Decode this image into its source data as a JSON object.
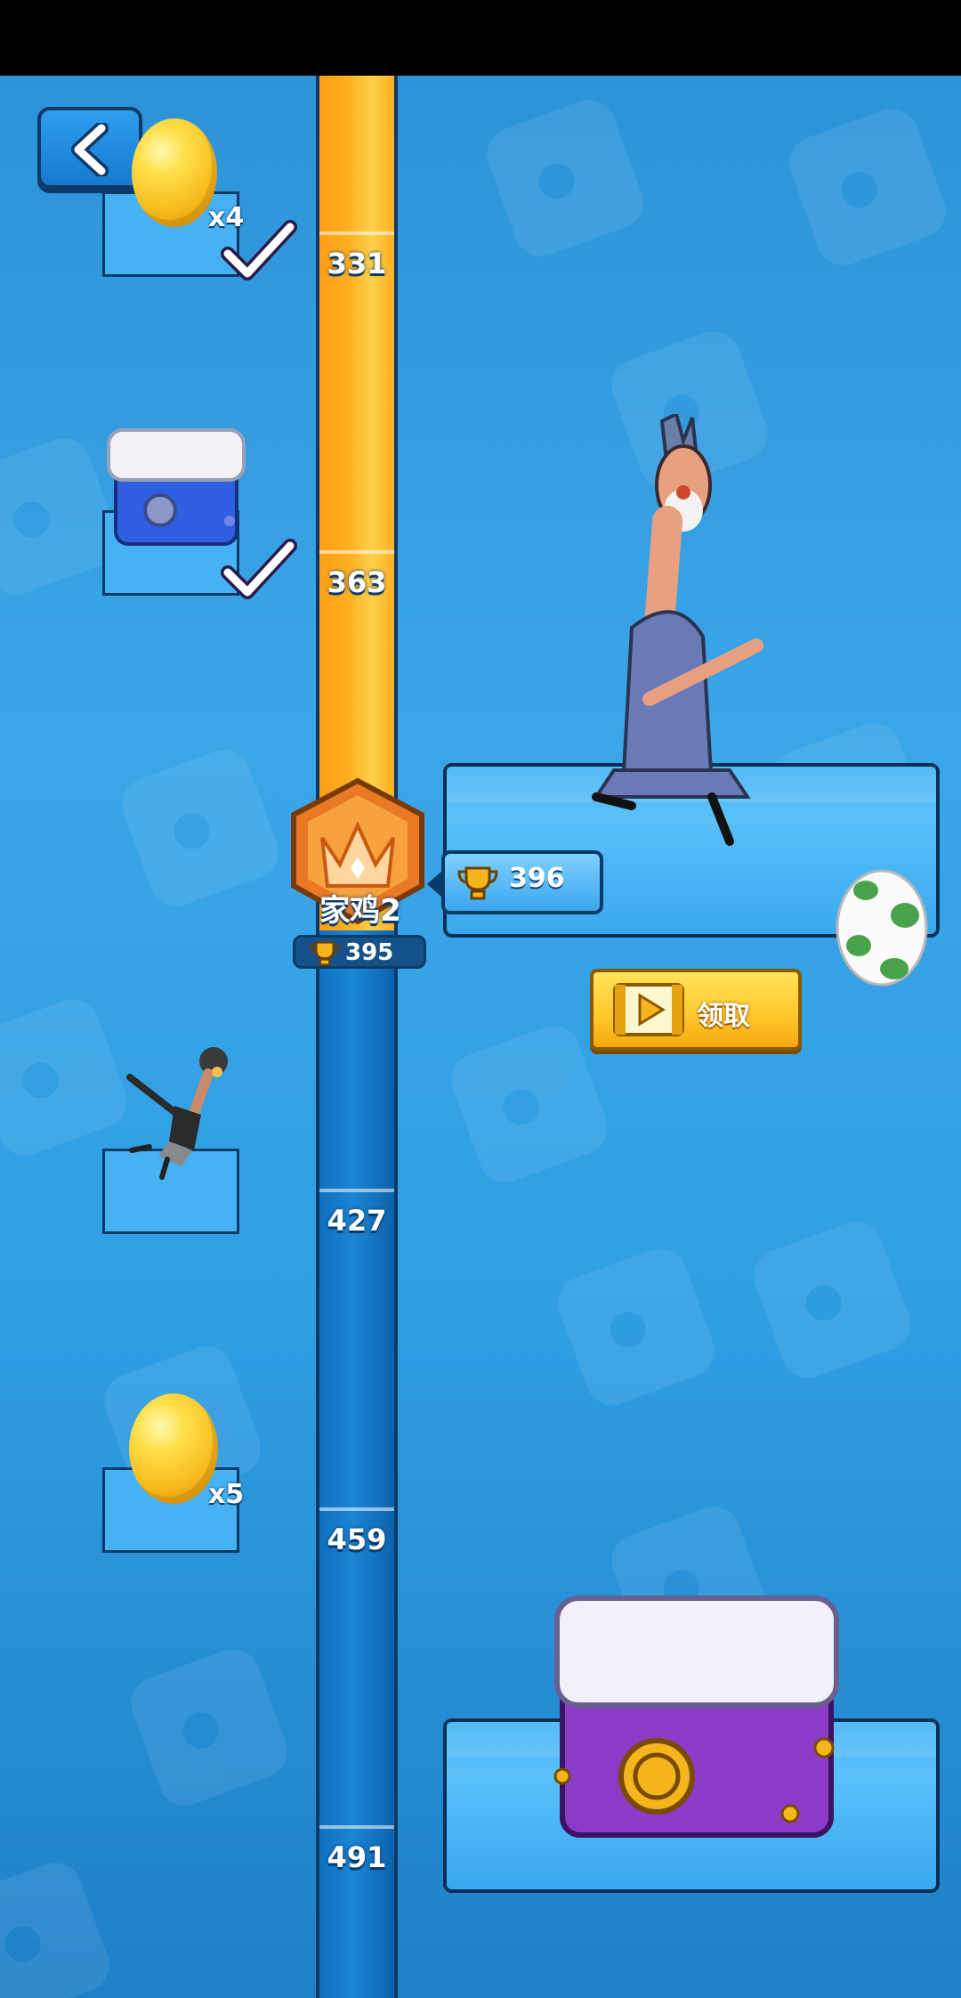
{
  "rail": {
    "ticks": [
      "331",
      "363",
      "427",
      "459",
      "491"
    ],
    "progress_trophies": 395
  },
  "rank": {
    "name": "家鸡2",
    "trophies": "395"
  },
  "rewards_left": [
    {
      "type": "golden-egg",
      "qty": "x4",
      "claimed": true,
      "milestone": "331"
    },
    {
      "type": "blue-chest",
      "qty": "",
      "claimed": true,
      "milestone": "363"
    },
    {
      "type": "chicken-skin",
      "qty": "",
      "claimed": false,
      "milestone": "427"
    },
    {
      "type": "golden-egg",
      "qty": "x5",
      "claimed": false,
      "milestone": "459"
    }
  ],
  "rewards_right": [
    {
      "type": "character-and-green-egg",
      "milestone": "396",
      "claim_label": "领取"
    },
    {
      "type": "purple-chest",
      "milestone": "491"
    }
  ],
  "colors": {
    "accent": "#ffc72b",
    "rail_orange": "#ffb021",
    "rail_blue": "#0f6fbf",
    "bg": "#2f9ee3"
  }
}
